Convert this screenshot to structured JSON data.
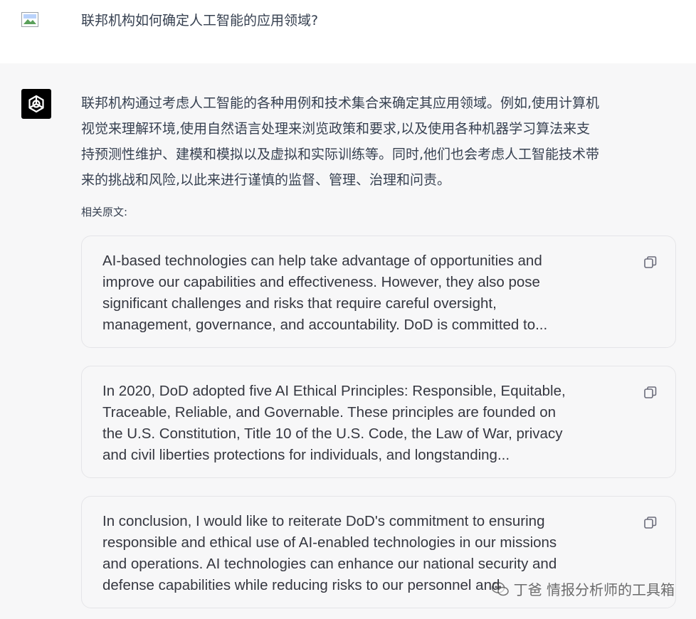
{
  "user_message": {
    "text": "联邦机构如何确定人工智能的应用领域?"
  },
  "assistant_message": {
    "answer_lines": [
      "联邦机构通过考虑人工智能的各种用例和技术集合来确定其应用领域。例如,使用计算机",
      "视觉来理解环境,使用自然语言处理来浏览政策和要求,以及使用各种机器学习算法来支",
      "持预测性维护、建模和模拟以及虚拟和实际训练等。同时,他们也会考虑人工智能技术带",
      "来的挑战和风险,以此来进行谨慎的监督、管理、治理和问责。"
    ],
    "related_label": "相关原文:",
    "sources": [
      {
        "lines": [
          "AI-based technologies can help take advantage of opportunities and",
          "improve our capabilities and effectiveness. However, they also pose",
          "significant challenges and risks that require careful oversight,",
          "management, governance, and accountability. DoD is committed to..."
        ]
      },
      {
        "lines": [
          "In 2020, DoD adopted five AI Ethical Principles: Responsible, Equitable,",
          "Traceable, Reliable, and Governable. These principles are founded on",
          "the U.S. Constitution, Title 10 of the U.S. Code, the Law of War, privacy",
          "and civil liberties protections for individuals, and longstanding..."
        ]
      },
      {
        "lines": [
          "In conclusion, I would like to reiterate DoD's commitment to ensuring",
          "responsible and ethical use of AI-enabled technologies in our missions",
          "and operations. AI technologies can enhance our national security and",
          "defense capabilities while reducing risks to our personnel and"
        ]
      }
    ]
  },
  "watermark": {
    "text": "丁爸 情报分析师的工具箱",
    "icon": "wechat-icon"
  },
  "icons": {
    "user_avatar": "broken-image-icon",
    "assistant_avatar": "openai-logo-icon",
    "copy": "copy-icon"
  }
}
